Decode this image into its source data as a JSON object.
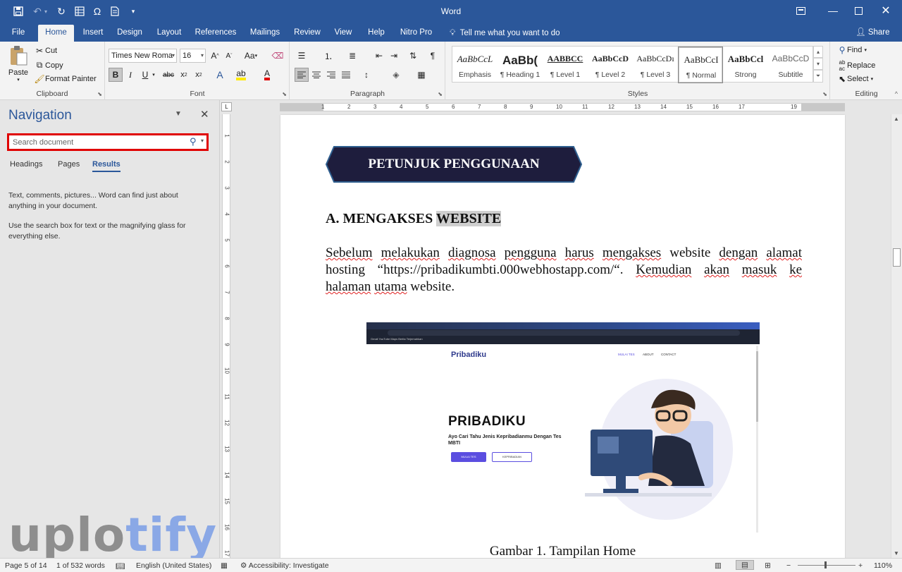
{
  "window": {
    "title": "Word"
  },
  "quick_access": {
    "save_icon": "save-icon",
    "undo_icon": "undo-icon",
    "redo_icon": "redo-icon"
  },
  "tabs": [
    {
      "label": "File"
    },
    {
      "label": "Home"
    },
    {
      "label": "Insert"
    },
    {
      "label": "Design"
    },
    {
      "label": "Layout"
    },
    {
      "label": "References"
    },
    {
      "label": "Mailings"
    },
    {
      "label": "Review"
    },
    {
      "label": "View"
    },
    {
      "label": "Help"
    },
    {
      "label": "Nitro Pro"
    }
  ],
  "active_tab": "Home",
  "tell_me": "Tell me what you want to do",
  "share": "Share",
  "ribbon": {
    "clipboard": {
      "paste": "Paste",
      "cut": "Cut",
      "copy": "Copy",
      "format_painter": "Format Painter",
      "label": "Clipboard"
    },
    "font": {
      "name": "Times New Roma",
      "size": "16",
      "label": "Font",
      "change_case": "Aa"
    },
    "paragraph": {
      "label": "Paragraph"
    },
    "styles": {
      "label": "Styles",
      "items": [
        {
          "preview": "AaBbCcL",
          "name": "Emphasis"
        },
        {
          "preview": "AaBb(",
          "name": "¶ Heading 1"
        },
        {
          "preview": "AABBCC",
          "name": "¶ Level 1"
        },
        {
          "preview": "AaBbCcD",
          "name": "¶ Level 2"
        },
        {
          "preview": "AaBbCcDı",
          "name": "¶ Level 3"
        },
        {
          "preview": "AaBbCcI",
          "name": "¶ Normal"
        },
        {
          "preview": "AaBbCcl",
          "name": "Strong"
        },
        {
          "preview": "AaBbCcD",
          "name": "Subtitle"
        }
      ],
      "selected": "¶ Normal"
    },
    "editing": {
      "find": "Find",
      "replace": "Replace",
      "select": "Select",
      "label": "Editing"
    }
  },
  "navigation": {
    "title": "Navigation",
    "search_placeholder": "Search document",
    "tabs": [
      {
        "label": "Headings"
      },
      {
        "label": "Pages"
      },
      {
        "label": "Results"
      }
    ],
    "active_tab": "Results",
    "help_1": "Text, comments, pictures... Word can find just about anything in your document.",
    "help_2": "Use the search box for text or the magnifying glass for everything else."
  },
  "document": {
    "banner": "PETUNJUK PENGGUNAAN",
    "heading_prefix": "A. MENGAKSES ",
    "heading_highlight": "WEBSITE",
    "paragraph": {
      "w1": "Sebelum",
      "w2": "melakukan",
      "w3": "diagnosa",
      "w4": "pengguna",
      "w5": "harus",
      "w6": "mengakses",
      "p1": " website ",
      "w7": "dengan",
      "w8": "alamat",
      "p2": " hosting “https://pribadikumbti.000webhostapp.com/“. ",
      "w9": "Kemudian",
      "w10": "akan",
      "w11": "masuk",
      "w12": "ke",
      "w13": "halaman",
      "w14": "utama",
      "p3": " website."
    },
    "screenshot": {
      "logo": "Pribadiku",
      "menu": [
        "MULAI TES",
        "ABOUT",
        "CONTACT"
      ],
      "hero_title": "PRIBADIKU",
      "hero_tagline": "Ayo Cari Tahu Jenis Kepribadianmu Dengan Tes MBTI",
      "btn_primary": "MULAI TES",
      "btn_secondary": "KEPRIBADIAN",
      "bookmarks": "Gmail   YouTube   Maps   Berita   Terjemahkan"
    },
    "caption": "Gambar 1. Tampilan Home"
  },
  "ruler": {
    "h": [
      "1",
      "2",
      "3",
      "4",
      "5",
      "6",
      "7",
      "8",
      "9",
      "10",
      "11",
      "12",
      "13",
      "14",
      "15",
      "16",
      "17",
      "19"
    ],
    "v": [
      "1",
      "2",
      "3",
      "4",
      "5",
      "6",
      "7",
      "8",
      "9",
      "10",
      "11",
      "12",
      "13",
      "14",
      "15",
      "16",
      "17"
    ]
  },
  "watermark": {
    "part1": "uplo",
    "part2": "tify"
  },
  "status": {
    "page": "Page 5 of 14",
    "words": "1 of 532 words",
    "language": "English (United States)",
    "accessibility": "Accessibility: Investigate",
    "zoom": "110%"
  },
  "colors": {
    "accent": "#2b579a",
    "highlight_box": "#e00000",
    "banner": "#1e1d3d"
  }
}
